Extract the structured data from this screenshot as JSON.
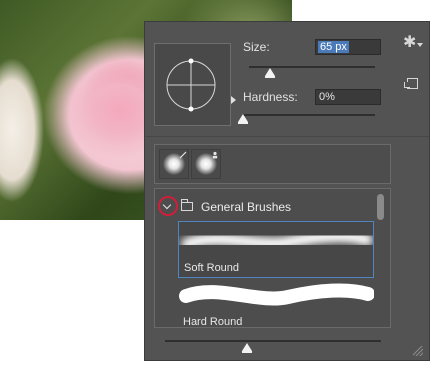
{
  "panel": {
    "size_label": "Size:",
    "size_value": "65 px",
    "hardness_label": "Hardness:",
    "hardness_value": "0%",
    "menu_icon": "gear-icon",
    "new_preset_icon": "new-preset-icon",
    "size_level_percent": 17,
    "hardness_level_percent": 0,
    "preview_level_percent": 38
  },
  "brush_list": {
    "group_label": "General Brushes",
    "items": [
      {
        "label": "Soft Round",
        "selected": true
      },
      {
        "label": "Hard Round",
        "selected": false
      }
    ]
  },
  "colors": {
    "panel_bg": "#535353",
    "selection_blue": "#4a7ab8",
    "highlight_red": "#cf1f3a"
  }
}
